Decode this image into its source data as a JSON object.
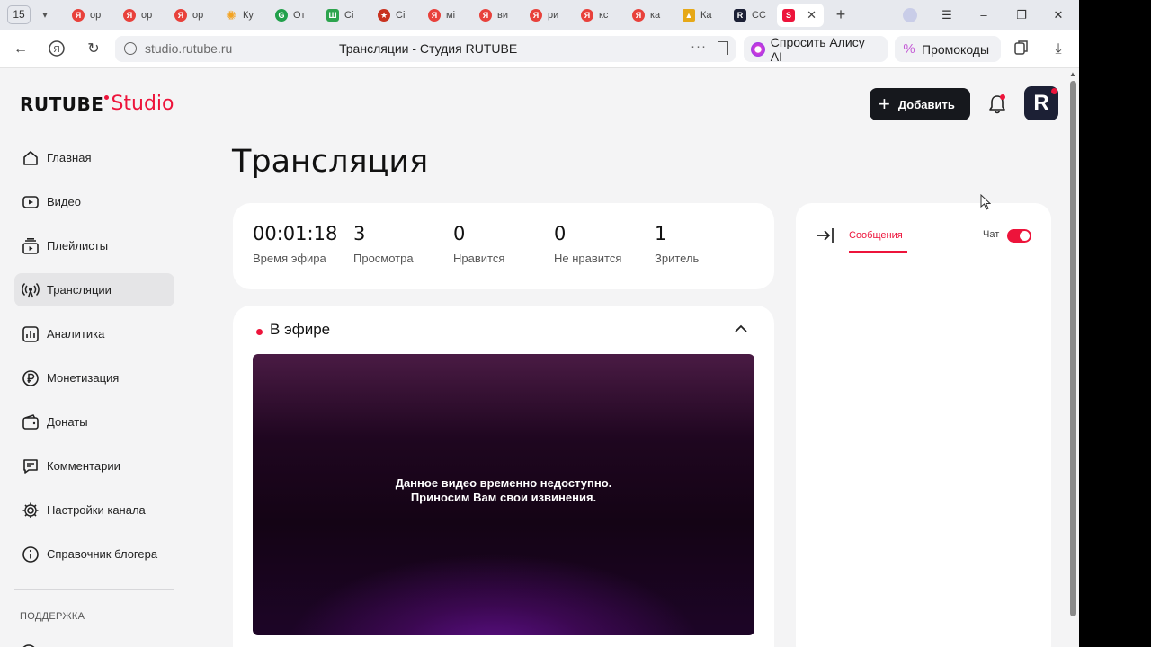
{
  "browser": {
    "tab_count": "15",
    "tabs": [
      {
        "label": "ор",
        "icon": "yandex-icon",
        "color": "#e8413b"
      },
      {
        "label": "ор",
        "icon": "yandex-icon",
        "color": "#e8413b"
      },
      {
        "label": "ор",
        "icon": "yandex-icon",
        "color": "#e8413b"
      },
      {
        "label": "Ку",
        "icon": "sun-icon",
        "color": "#f3a322"
      },
      {
        "label": "От",
        "icon": "g-icon",
        "color": "#22a04b"
      },
      {
        "label": "Сі",
        "icon": "shop-icon",
        "color": "#2da44e"
      },
      {
        "label": "Сі",
        "icon": "emblem-icon",
        "color": "#c8321f"
      },
      {
        "label": "мі",
        "icon": "yandex-icon",
        "color": "#e8413b"
      },
      {
        "label": "ви",
        "icon": "yandex-icon",
        "color": "#e8413b"
      },
      {
        "label": "ри",
        "icon": "yandex-icon",
        "color": "#e8413b"
      },
      {
        "label": "кс",
        "icon": "yandex-icon",
        "color": "#e8413b"
      },
      {
        "label": "ка",
        "icon": "yandex-icon",
        "color": "#e8413b"
      },
      {
        "label": "Ка",
        "icon": "picture-icon",
        "color": "#e6a817"
      },
      {
        "label": "СС",
        "icon": "rutube-icon",
        "color": "#1c2035"
      }
    ],
    "active_tab_icon": "rutube-studio-icon",
    "url": "studio.rutube.ru",
    "page_title": "Трансляции - Студия RUTUBE",
    "alice_label": "Спросить Алису AI",
    "promo_label": "Промокоды"
  },
  "header": {
    "logo_brand": "RUTUBE",
    "logo_product": "Studio",
    "add_button": "Добавить",
    "avatar_letter": "R"
  },
  "sidebar": {
    "items": [
      {
        "label": "Главная",
        "icon": "home-icon"
      },
      {
        "label": "Видео",
        "icon": "video-icon"
      },
      {
        "label": "Плейлисты",
        "icon": "playlist-icon"
      },
      {
        "label": "Трансляции",
        "icon": "broadcast-icon",
        "active": true
      },
      {
        "label": "Аналитика",
        "icon": "analytics-icon"
      },
      {
        "label": "Монетизация",
        "icon": "ruble-icon"
      },
      {
        "label": "Донаты",
        "icon": "wallet-icon"
      },
      {
        "label": "Комментарии",
        "icon": "comment-icon"
      },
      {
        "label": "Настройки канала",
        "icon": "gear-icon"
      },
      {
        "label": "Справочник блогера",
        "icon": "info-icon"
      }
    ],
    "support_heading": "ПОДДЕРЖКА"
  },
  "main": {
    "title": "Трансляция",
    "stats": [
      {
        "value": "00:01:18",
        "label": "Время эфира"
      },
      {
        "value": "3",
        "label": "Просмотра"
      },
      {
        "value": "0",
        "label": "Нравится"
      },
      {
        "value": "0",
        "label": "Не нравится"
      },
      {
        "value": "1",
        "label": "Зритель"
      }
    ],
    "live": {
      "status": "В эфире",
      "message_line1": "Данное видео временно недоступно.",
      "message_line2": "Приносим Вам свои извинения."
    }
  },
  "chat": {
    "tab_messages": "Сообщения",
    "toggle_label": "Чат",
    "toggle_on": true
  },
  "colors": {
    "accent": "#ed143b",
    "dark_button": "#16181d",
    "page_bg": "#f4f4f5"
  }
}
